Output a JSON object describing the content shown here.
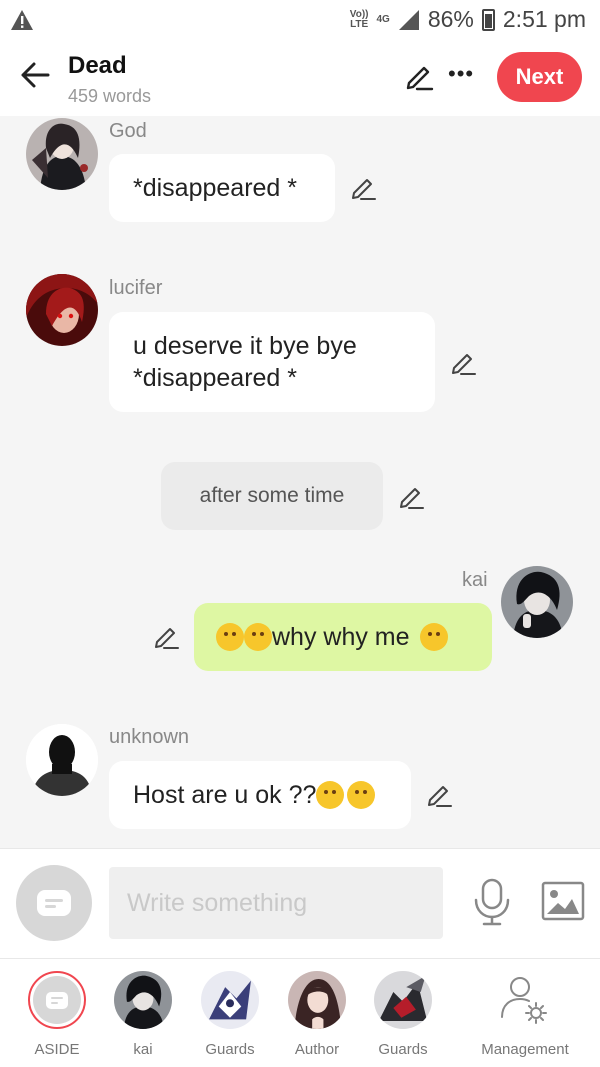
{
  "status_bar": {
    "network_top": "Vo))",
    "network_bottom": "LTE",
    "signal_type": "4G",
    "battery": "86%",
    "time": "2:51 pm"
  },
  "header": {
    "title": "Dead",
    "word_count": "459 words",
    "next_label": "Next"
  },
  "messages": [
    {
      "type": "left",
      "sender": "God",
      "text": "*disappeared *"
    },
    {
      "type": "left",
      "sender": "lucifer",
      "lines": [
        "u deserve it bye bye",
        "*disappeared *"
      ]
    },
    {
      "type": "narration",
      "text": "after some time"
    },
    {
      "type": "right",
      "sender": "kai",
      "text": "why why me"
    },
    {
      "type": "left",
      "sender": "unknown",
      "text": "Host are u ok ??"
    }
  ],
  "composer": {
    "placeholder": "Write something"
  },
  "characters": [
    {
      "label": "ASIDE"
    },
    {
      "label": "kai"
    },
    {
      "label": "Guards"
    },
    {
      "label": "Author"
    },
    {
      "label": "Guards"
    },
    {
      "label": "Management"
    }
  ],
  "colors": {
    "accent": "#f0464f",
    "own_bubble": "#def7a3",
    "other_bubble": "#ffffff",
    "narration_bubble": "#ebebeb",
    "chat_background": "#f5f5f5"
  },
  "icons": {
    "back": "arrow-left-icon",
    "edit": "pencil-icon",
    "more": "more-dots-icon",
    "mic": "microphone-icon",
    "image": "image-icon",
    "warning": "warning-icon",
    "management": "user-gear-icon"
  }
}
